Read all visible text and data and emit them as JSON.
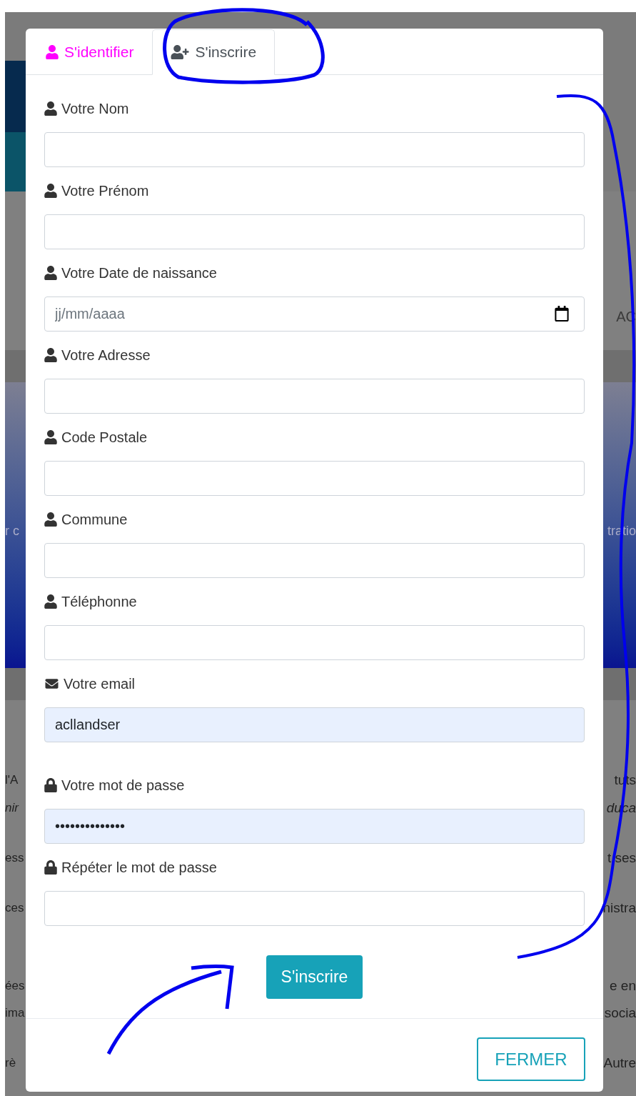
{
  "background": {
    "side_fragment": "AC",
    "banner": {
      "left": "r c",
      "right": "tratio"
    },
    "text_lines": [
      {
        "left": "l'A",
        "right": "tuts",
        "italic": false
      },
      {
        "left": "nir",
        "right": "duca",
        "italic": true
      },
      {
        "left": "ess",
        "right": "t ses",
        "italic": false
      },
      {
        "left": "ces",
        "right": "nistra",
        "italic": false
      },
      {
        "left": "ées",
        "right": "e en",
        "italic": false
      },
      {
        "left": "ima",
        "right": "socia",
        "italic": false
      },
      {
        "left": "rè",
        "right": "Autre",
        "italic": false
      }
    ]
  },
  "dialog": {
    "tabs": [
      {
        "label": "S'identifier",
        "selected": false
      },
      {
        "label": "S'inscrire",
        "selected": true
      }
    ],
    "fields": [
      {
        "label": "Votre Nom",
        "kind": "text",
        "autofilled": false
      },
      {
        "label": "Votre Prénom",
        "kind": "text",
        "autofilled": false
      },
      {
        "label": "Votre Date de naissance",
        "kind": "date",
        "placeholder": "jj/mm/aaaa",
        "autofilled": false
      },
      {
        "label": "Votre Adresse",
        "kind": "text",
        "autofilled": false
      },
      {
        "label": "Code Postale",
        "kind": "text",
        "autofilled": false
      },
      {
        "label": "Commune",
        "kind": "text",
        "autofilled": false
      },
      {
        "label": "Téléphonne",
        "kind": "text",
        "autofilled": false
      },
      {
        "label": "Votre email",
        "kind": "email",
        "value": "acllandser",
        "autofilled": true
      },
      {
        "label": "Votre mot de passe",
        "kind": "password",
        "value": "••••••••••••••",
        "autofilled": true
      },
      {
        "label": "Répéter le mot de passe",
        "kind": "password",
        "autofilled": false
      }
    ],
    "submit": "S'inscrire",
    "close": "FERMER"
  }
}
